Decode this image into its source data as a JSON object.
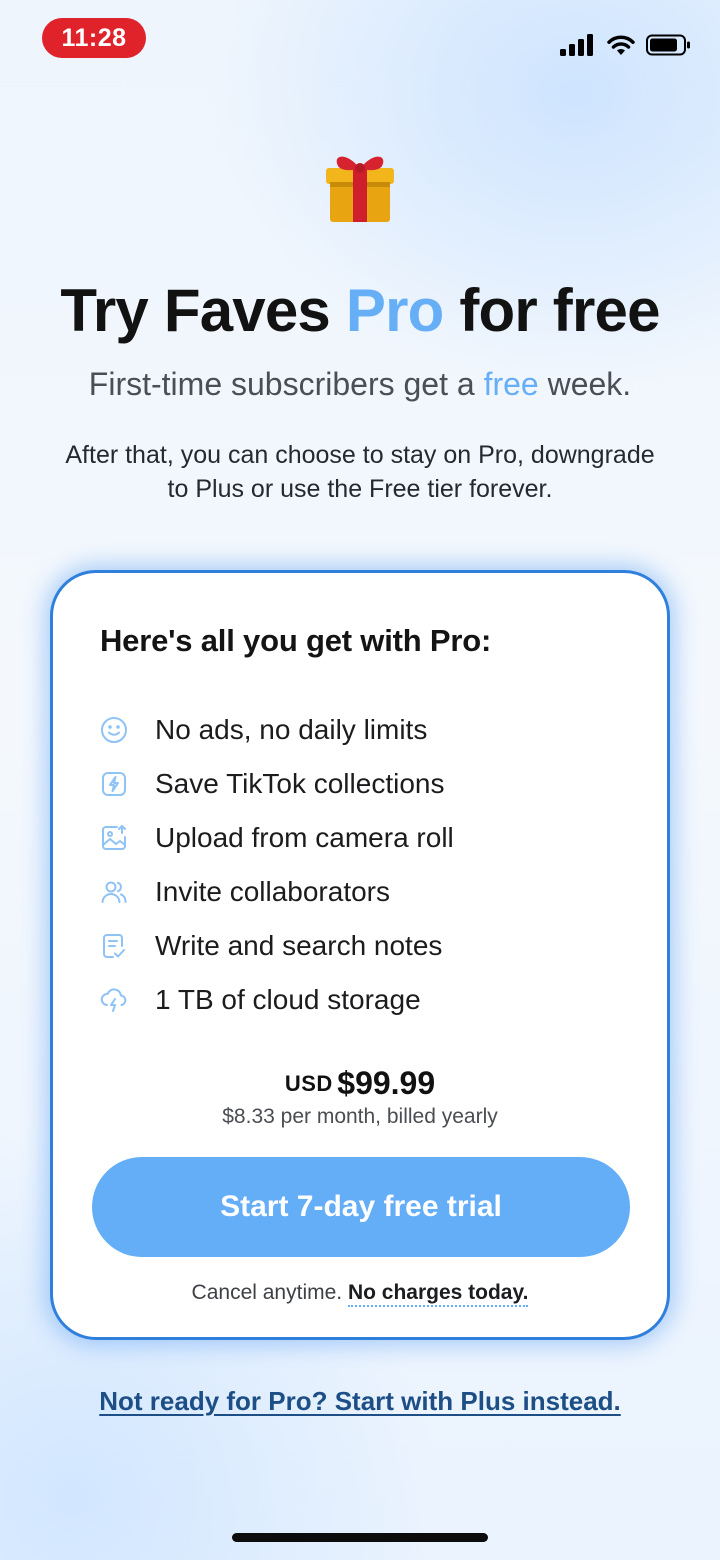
{
  "status_bar": {
    "time": "11:28",
    "icons": [
      "cellular-signal-icon",
      "wifi-icon",
      "battery-icon"
    ]
  },
  "hero": {
    "icon": "gift-icon",
    "title_part1": "Try Faves ",
    "title_accent": "Pro",
    "title_part2": " for free",
    "subtitle_part1": "First-time subscribers get a ",
    "subtitle_accent": "free",
    "subtitle_part2": " week.",
    "description": "After that, you can choose to stay on Pro, downgrade to Plus or use the Free tier forever."
  },
  "card": {
    "heading": "Here's all you get with Pro:",
    "features": [
      {
        "icon": "smiley-icon",
        "label": "No ads, no daily limits"
      },
      {
        "icon": "lightning-icon",
        "label": "Save TikTok collections"
      },
      {
        "icon": "image-upload-icon",
        "label": "Upload from camera roll"
      },
      {
        "icon": "users-icon",
        "label": "Invite collaborators"
      },
      {
        "icon": "notes-icon",
        "label": "Write and search notes"
      },
      {
        "icon": "cloud-lightning-icon",
        "label": "1 TB of cloud storage"
      }
    ],
    "price": {
      "currency": "USD",
      "amount": "$99.99",
      "detail": "$8.33 per month, billed yearly"
    },
    "cta_label": "Start 7-day free trial",
    "fine_print_part1": "Cancel anytime. ",
    "fine_print_bold": "No charges today."
  },
  "footer": {
    "plus_link": "Not ready for Pro? Start with Plus instead."
  },
  "colors": {
    "accent": "#66aef6",
    "card_border": "#2f7fdc",
    "button": "#64adf7",
    "link": "#1d4f86",
    "time_pill": "#e0222b"
  }
}
